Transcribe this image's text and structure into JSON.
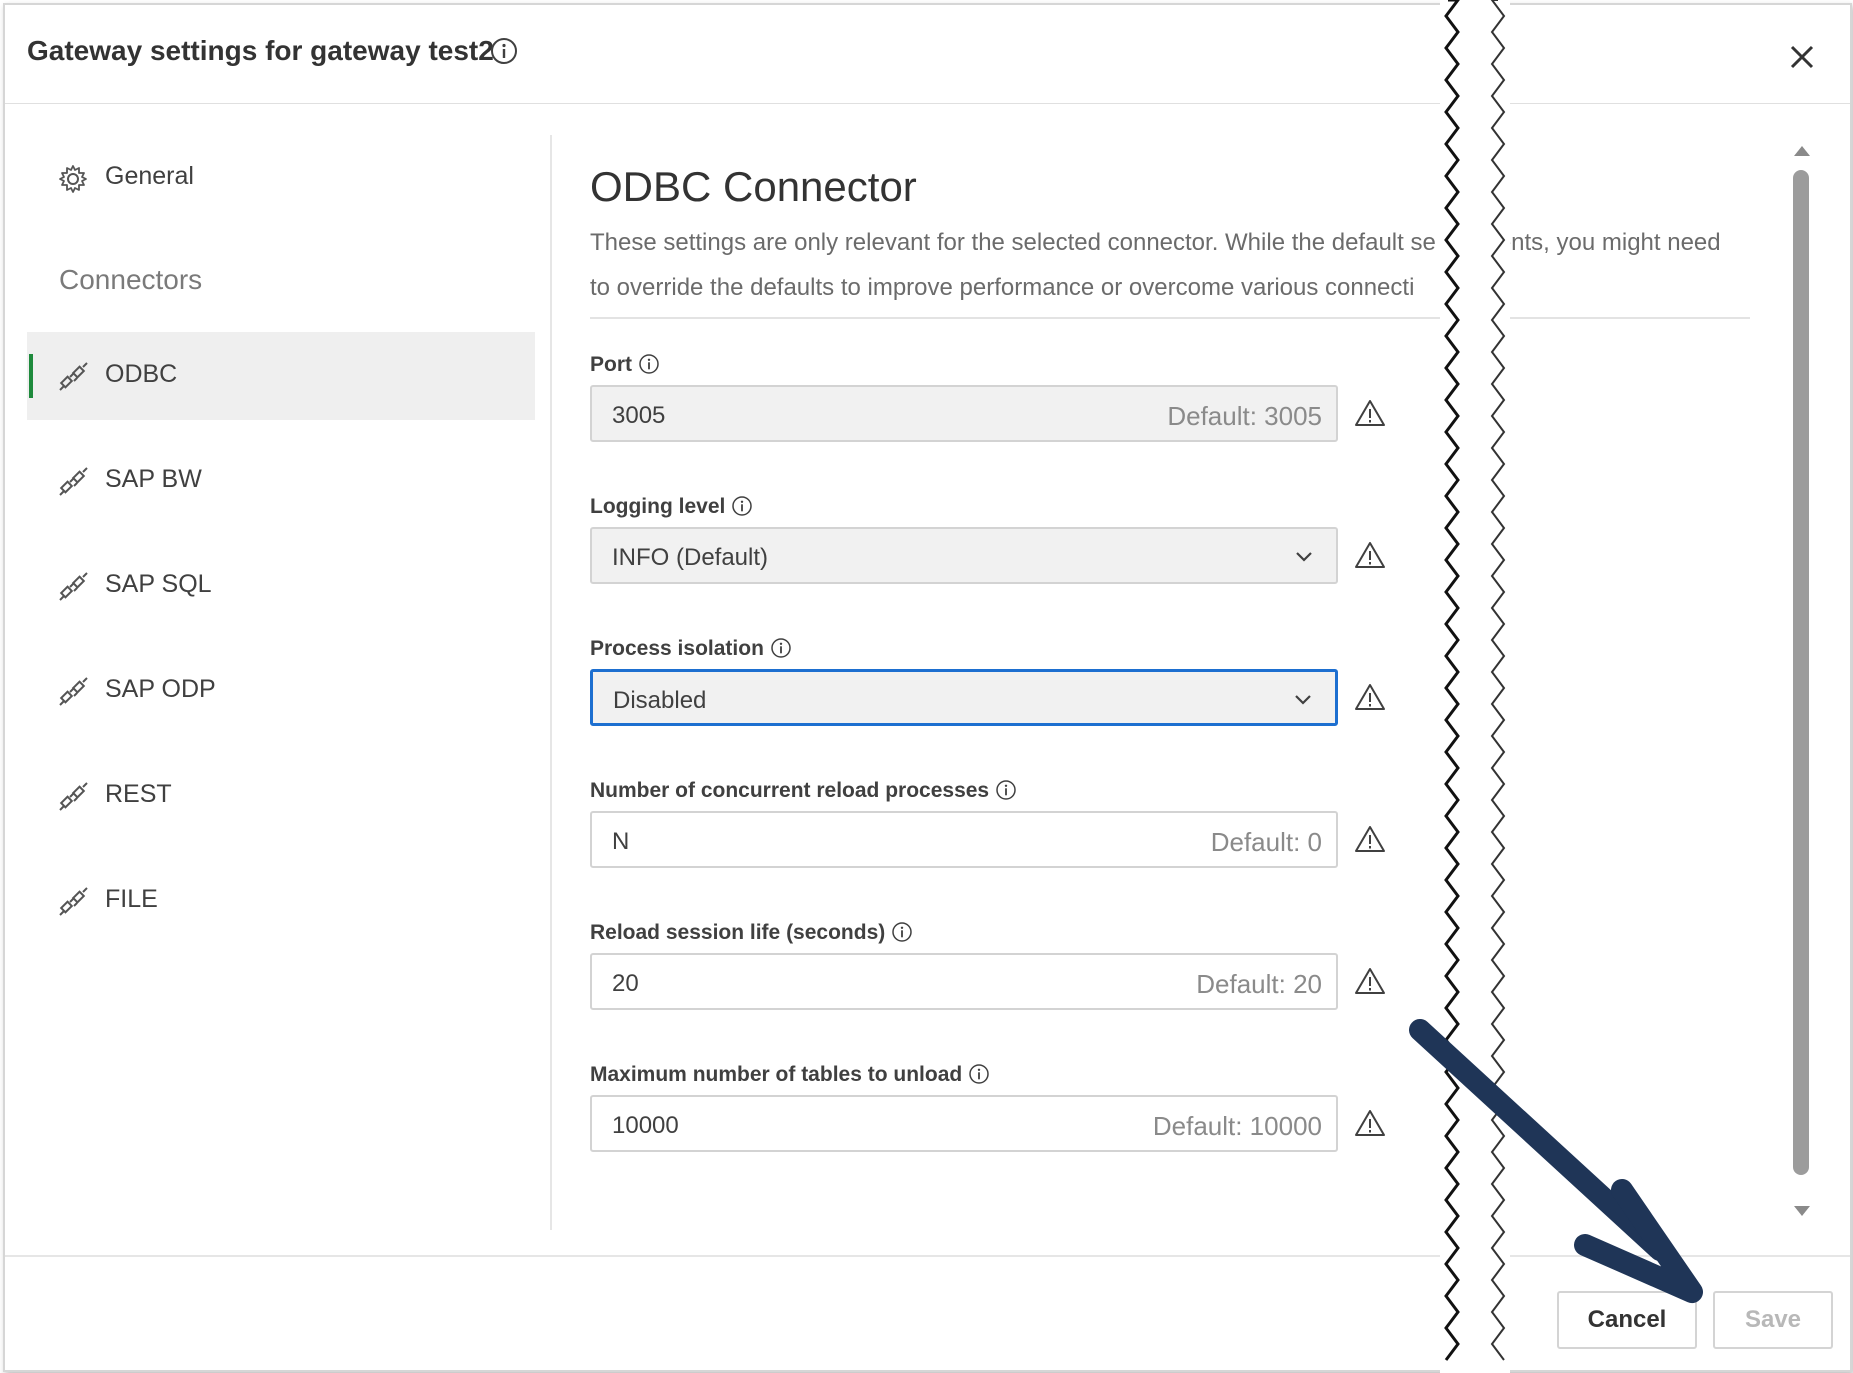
{
  "dialog": {
    "title": "Gateway settings for gateway test2"
  },
  "sidebar": {
    "general_label": "General",
    "section_label": "Connectors",
    "items": [
      {
        "label": "ODBC"
      },
      {
        "label": "SAP BW"
      },
      {
        "label": "SAP SQL"
      },
      {
        "label": "SAP ODP"
      },
      {
        "label": "REST"
      },
      {
        "label": "FILE"
      }
    ]
  },
  "main": {
    "heading": "ODBC Connector",
    "description_line1": "These settings are only relevant for the selected connector. While the default se",
    "description_line1b": "ents, you might need",
    "description_line2": "to override the defaults to improve performance or overcome various connecti",
    "fields": [
      {
        "label": "Port",
        "value": "3005",
        "default": "Default: 3005"
      },
      {
        "label": "Logging level",
        "value": "INFO (Default)"
      },
      {
        "label": "Process isolation",
        "value": "Disabled"
      },
      {
        "label": "Number of concurrent reload processes",
        "value": "N",
        "default": "Default: 0"
      },
      {
        "label": "Reload session life (seconds)",
        "value": "20",
        "default": "Default: 20"
      },
      {
        "label": "Maximum number of tables to unload",
        "value": "10000",
        "default": "Default: 10000"
      }
    ]
  },
  "footer": {
    "cancel_label": "Cancel",
    "save_label": "Save"
  },
  "colors": {
    "accent": "#1d6fd0",
    "active_indicator": "#1e8a3c",
    "arrow": "#1f3557"
  }
}
